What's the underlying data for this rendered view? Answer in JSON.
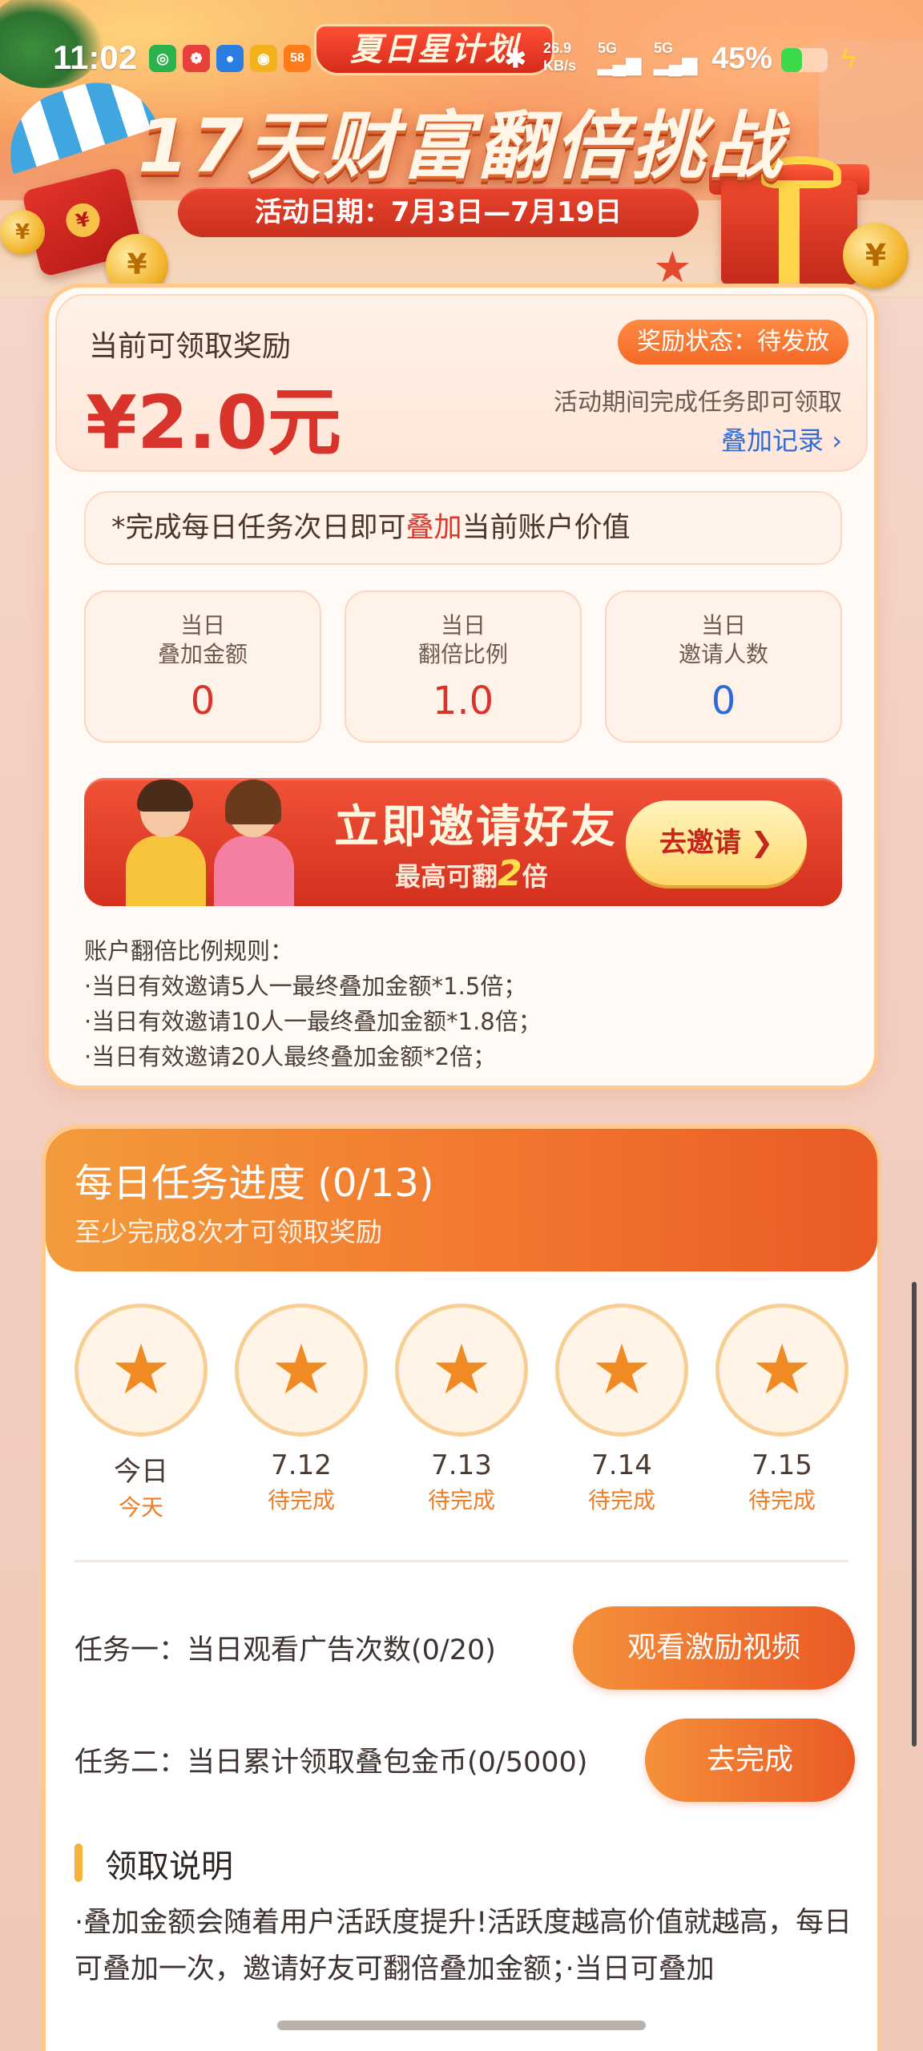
{
  "status_bar": {
    "time": "11:02",
    "net_speed_top": "26.9",
    "net_speed_unit": "KB/s",
    "sim1": "5G",
    "sim2": "5G",
    "battery": "45%",
    "battery_level": 0.45,
    "app_icons": [
      "app-icon-green",
      "app-icon-red",
      "app-icon-blue",
      "app-icon-yellow",
      "58"
    ]
  },
  "hero": {
    "plan_badge": "夏日星计划",
    "title": "17天财富翻倍挑战",
    "date_range": "活动日期：7月3日—7月19日"
  },
  "reward": {
    "label": "当前可领取奖励",
    "value": "¥2.0元",
    "status": "奖励状态：待发放",
    "hint": "活动期间完成任务即可领取",
    "record_link": "叠加记录 ›"
  },
  "notice": {
    "prefix": "*完成每日任务次日即可",
    "highlight": "叠加",
    "suffix": "当前账户价值"
  },
  "stats": [
    {
      "line1": "当日",
      "line2": "叠加金额",
      "value": "0",
      "color": "#d9342b"
    },
    {
      "line1": "当日",
      "line2": "翻倍比例",
      "value": "1.0",
      "color": "#d9342b"
    },
    {
      "line1": "当日",
      "line2": "邀请人数",
      "value": "0",
      "color": "#2f6bd6"
    }
  ],
  "invite": {
    "title": "立即邀请好友",
    "sub_prefix": "最高可翻",
    "sub_num": "2",
    "sub_suffix": "倍",
    "button": "去邀请 ❯"
  },
  "rules": {
    "title": "账户翻倍比例规则：",
    "items": [
      "·当日有效邀请5人一最终叠加金额*1.5倍；",
      "·当日有效邀请10人一最终叠加金额*1.8倍；",
      "·当日有效邀请20人最终叠加金额*2倍；"
    ]
  },
  "tasks": {
    "title": "每日任务进度 (0/13)",
    "subtitle": "至少完成8次才可领取奖励",
    "days": [
      {
        "date": "今日",
        "status": "今天"
      },
      {
        "date": "7.12",
        "status": "待完成"
      },
      {
        "date": "7.13",
        "status": "待完成"
      },
      {
        "date": "7.14",
        "status": "待完成"
      },
      {
        "date": "7.15",
        "status": "待完成"
      }
    ],
    "task1_label": "任务一：当日观看广告次数(0/20)",
    "task1_button": "观看激励视频",
    "task2_label": "任务二：当日累计领取叠包金币(0/5000)",
    "task2_button": "去完成"
  },
  "instructions": {
    "title": "领取说明",
    "text": "·叠加金额会随着用户活跃度提升!活跃度越高价值就越高，每日可叠加一次，邀请好友可翻倍叠加金额；·当日可叠加"
  },
  "colors": {
    "accent_red": "#d9342b",
    "accent_orange": "#f27a2f",
    "link_blue": "#2f6bd6",
    "card_border": "#ffc98d"
  }
}
